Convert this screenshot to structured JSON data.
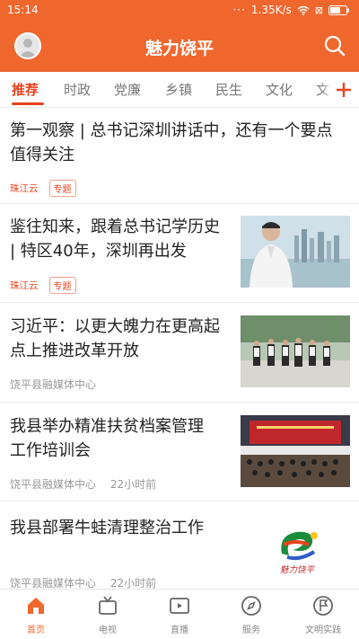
{
  "status_bar": {
    "time": "15:14",
    "dots": "···",
    "speed": "1.35K/s",
    "battery_label": "⊠"
  },
  "header": {
    "title": "魅力饶平"
  },
  "tabs": [
    "推荐",
    "时政",
    "党廉",
    "乡镇",
    "民生",
    "文化",
    "文"
  ],
  "news": [
    {
      "title_lines": [
        "第一观察 | 总书记深圳讲话中，还有一个要点",
        "值得关注"
      ],
      "source": "珠江云",
      "tag": "专题"
    },
    {
      "title_lines": [
        "鉴往知来，跟着总书记学历史",
        "| 特区40年，深圳再出发"
      ],
      "source": "珠江云",
      "tag": "专题"
    },
    {
      "title_lines": [
        "习近平：以更大魄力在更高起",
        "点上推进改革开放"
      ],
      "source": "饶平县融媒体中心"
    },
    {
      "title_lines": [
        "我县举办精准扶贫档案管理",
        "工作培训会"
      ],
      "source": "饶平县融媒体中心",
      "time": "22小时前"
    },
    {
      "title_lines": [
        "我县部署牛蛙清理整治工作"
      ],
      "source": "饶平县融媒体中心",
      "time": "22小时前",
      "logo_text": "魅力饶平"
    }
  ],
  "bottom_nav": [
    "首页",
    "电视",
    "直播",
    "服务",
    "文明实践"
  ],
  "colors": {
    "brand": "#f0672e",
    "accent": "#e8431e"
  }
}
